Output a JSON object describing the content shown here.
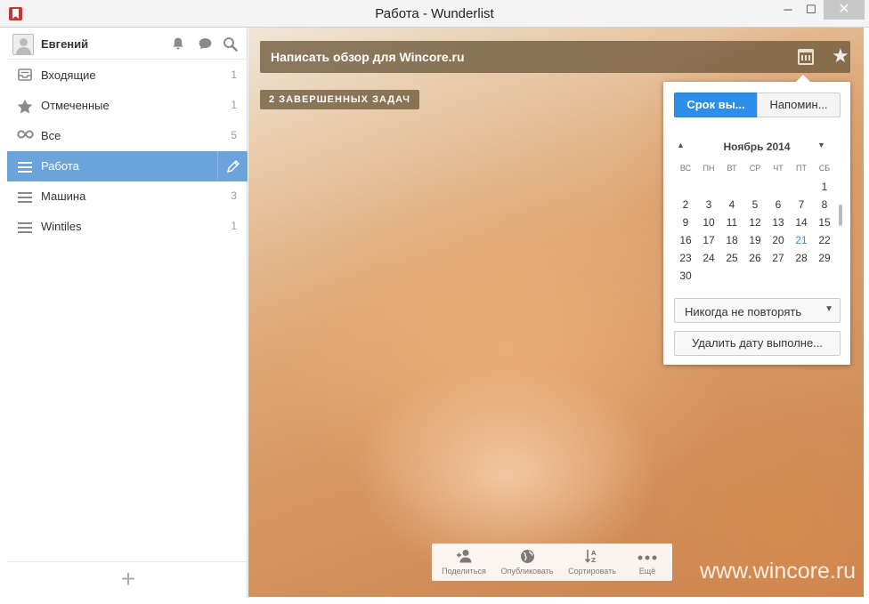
{
  "window": {
    "title": "Работа - Wunderlist",
    "min_glyph": "─",
    "max_glyph": "☐",
    "close_glyph": "✕"
  },
  "sidebar": {
    "user_name": "Евгений",
    "items": [
      {
        "label": "Входящие",
        "count": "1",
        "icon": "inbox-icon"
      },
      {
        "label": "Отмеченные",
        "count": "1",
        "icon": "star-icon"
      },
      {
        "label": "Все",
        "count": "5",
        "icon": "infinity-icon"
      },
      {
        "label": "Работа",
        "count": "",
        "icon": "list-icon"
      },
      {
        "label": "Машина",
        "count": "3",
        "icon": "list-icon"
      },
      {
        "label": "Wintiles",
        "count": "1",
        "icon": "list-icon"
      }
    ],
    "add_glyph": "+"
  },
  "task": {
    "title": "Написать обзор для Wincore.ru",
    "completed_label": "2 ЗАВЕРШЕННЫХ ЗАДАЧ"
  },
  "date_popover": {
    "due_tab": "Срок вы...",
    "remind_tab": "Напомин...",
    "month": "Ноябрь 2014",
    "weekdays": [
      "ВС",
      "ПН",
      "ВТ",
      "СР",
      "ЧТ",
      "ПТ",
      "СБ"
    ],
    "days": [
      "",
      "",
      "",
      "",
      "",
      "",
      "1",
      "2",
      "3",
      "4",
      "5",
      "6",
      "7",
      "8",
      "9",
      "10",
      "11",
      "12",
      "13",
      "14",
      "15",
      "16",
      "17",
      "18",
      "19",
      "20",
      "21",
      "22",
      "23",
      "24",
      "25",
      "26",
      "27",
      "28",
      "29",
      "30"
    ],
    "today": "21",
    "repeat_value": "Никогда не повторять",
    "clear_label": "Удалить дату выполне..."
  },
  "toolbar": {
    "share": "Поделиться",
    "publish": "Опубликовать",
    "sort": "Сортировать",
    "more": "Ещё"
  },
  "watermark": "www.wincore.ru",
  "colors": {
    "accent": "#6ba3db",
    "due_tab": "#2d8ee9",
    "task_bar": "#6e5a3c"
  }
}
